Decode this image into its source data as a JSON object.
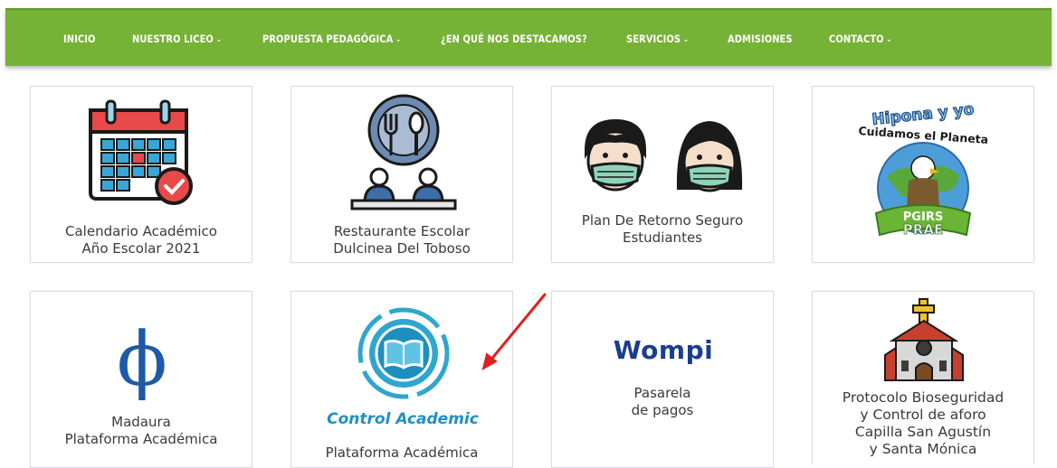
{
  "nav": {
    "items": [
      {
        "label": "INICIO",
        "dropdown": false
      },
      {
        "label": "NUESTRO LICEO",
        "dropdown": true
      },
      {
        "label": "PROPUESTA PEDAGÓGICA",
        "dropdown": true
      },
      {
        "label": "¿EN QUÉ NOS DESTACAMOS?",
        "dropdown": false
      },
      {
        "label": "SERVICIOS",
        "dropdown": true
      },
      {
        "label": "ADMISIONES",
        "dropdown": false
      },
      {
        "label": "CONTACTO",
        "dropdown": true
      }
    ],
    "chevron": "⌄"
  },
  "cards": [
    {
      "line1": "Calendario Académico",
      "line2": "Año Escolar 2021",
      "icon": "calendar-icon"
    },
    {
      "line1": "Restaurante Escolar",
      "line2": "Dulcinea Del Toboso",
      "icon": "restaurant-icon"
    },
    {
      "line1": "Plan De Retorno Seguro",
      "line2": "Estudiantes",
      "icon": "face-mask-icon"
    },
    {
      "icon": "hipona-prae-logo",
      "logo_text": [
        "Hipona y yo",
        "Cuidamos el Planeta",
        "PGIRS",
        "PRAE"
      ]
    },
    {
      "line1": "Madaura",
      "line2": "Plataforma Académica",
      "icon": "phi-icon",
      "symbol": "ϕ"
    },
    {
      "line1": "Plataforma Académica",
      "icon": "control-academic-logo",
      "logo_text": "Control Academic"
    },
    {
      "line1": "Pasarela",
      "line2": "de pagos",
      "icon": "wompi-logo",
      "logo_text": "Wompi"
    },
    {
      "line1": "Protocolo Bioseguridad",
      "line2": "y Control de aforo",
      "line3": "Capilla San Agustín",
      "line4": "y Santa Mónica",
      "icon": "church-icon"
    }
  ],
  "colors": {
    "nav": "#76b236",
    "arrow": "#e02020",
    "wompi": "#1b3d8f",
    "phi": "#1d5aa8"
  }
}
